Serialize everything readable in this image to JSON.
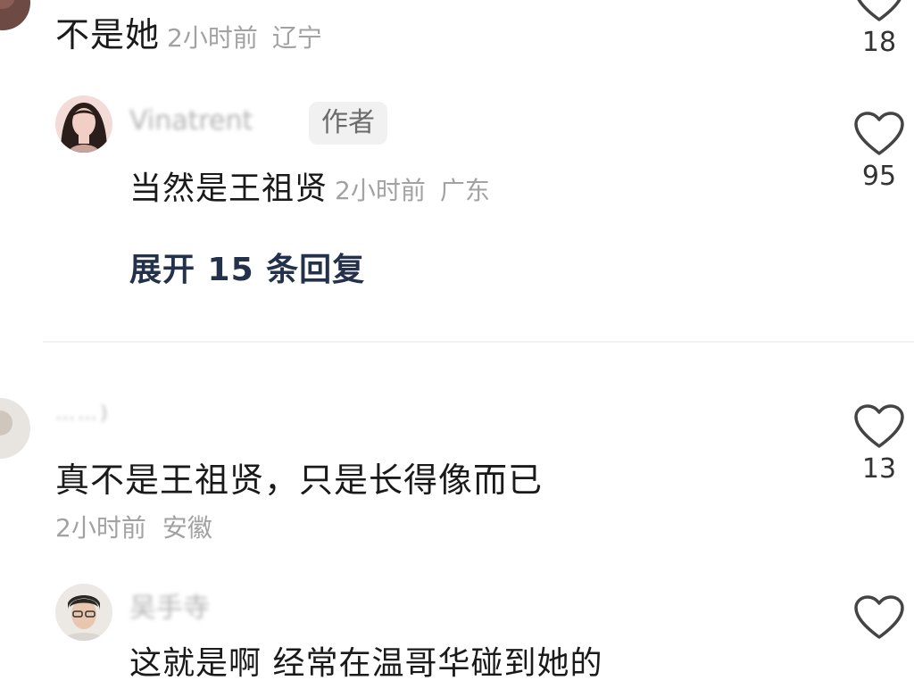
{
  "comments": [
    {
      "text": "不是她",
      "time": "2小时前",
      "location": "辽宁",
      "likes": "18",
      "replies": [
        {
          "username": "Vinatrent",
          "badge": "作者",
          "text": "当然是王祖贤",
          "time": "2小时前",
          "location": "广东",
          "likes": "95"
        }
      ],
      "expand_label": "展开 15 条回复"
    },
    {
      "username": "……)",
      "text": "真不是王祖贤，只是长得像而已",
      "time": "2小时前",
      "location": "安徽",
      "likes": "13",
      "replies": [
        {
          "username": "吴手寺",
          "text": "这就是啊 经常在温哥华碰到她的"
        }
      ]
    }
  ],
  "colors": {
    "meta": "#a2a2a2",
    "expand": "#23314b",
    "badge_bg": "#f1f1f1",
    "divider": "#f3f3f3"
  }
}
